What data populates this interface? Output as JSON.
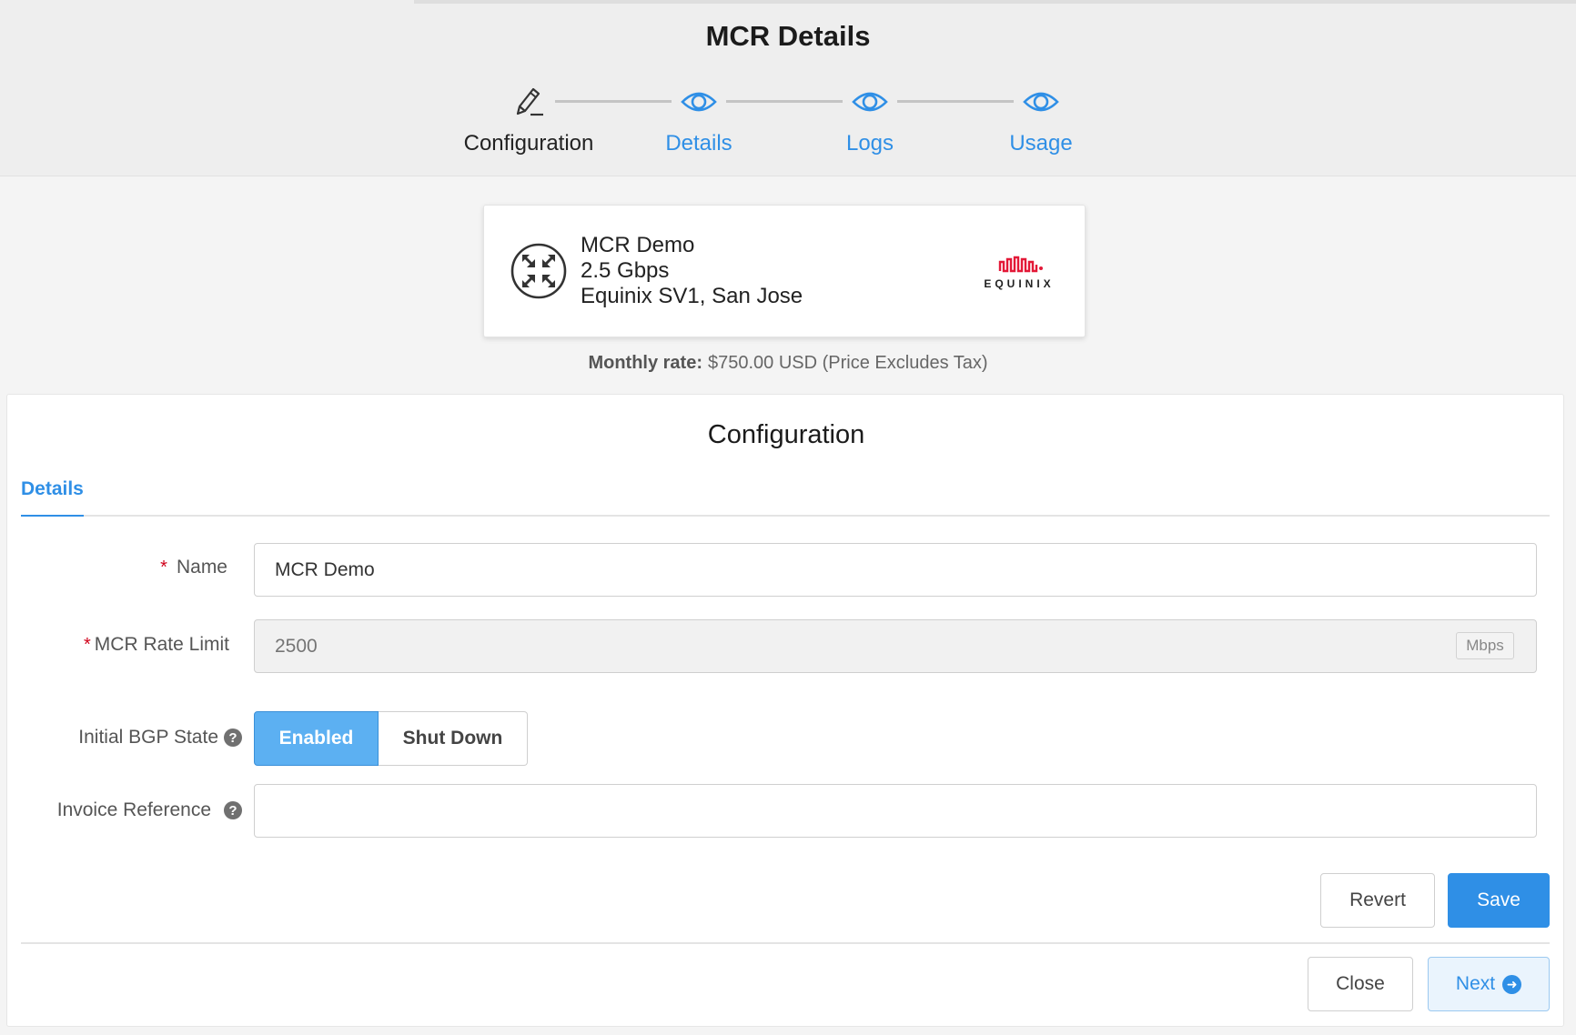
{
  "header": {
    "title": "MCR Details",
    "steps": [
      {
        "label": "Configuration",
        "icon": "pencil-icon",
        "active": true
      },
      {
        "label": "Details",
        "icon": "eye-icon",
        "active": false
      },
      {
        "label": "Logs",
        "icon": "eye-icon",
        "active": false
      },
      {
        "label": "Usage",
        "icon": "eye-icon",
        "active": false
      }
    ]
  },
  "summary": {
    "name": "MCR Demo",
    "speed": "2.5 Gbps",
    "location": "Equinix SV1, San Jose",
    "provider_logo_text": "EQUINIX",
    "icon": "mcr-arrows-icon",
    "rate_label": "Monthly rate:",
    "rate_value": "$750.00 USD (Price Excludes Tax)"
  },
  "config": {
    "title": "Configuration",
    "tab_label": "Details",
    "name_field": {
      "label": "Name",
      "required_mark": "*",
      "value": "MCR Demo"
    },
    "rate_limit_field": {
      "label": "MCR Rate Limit",
      "required_mark": "*",
      "placeholder": "2500",
      "unit": "Mbps"
    },
    "bgp_state": {
      "label": "Initial BGP State",
      "help": "?",
      "enabled_label": "Enabled",
      "shutdown_label": "Shut Down",
      "selected": "Enabled"
    },
    "invoice_field": {
      "label": "Invoice Reference",
      "help": "?",
      "value": ""
    },
    "revert_label": "Revert",
    "save_label": "Save"
  },
  "footer": {
    "close_label": "Close",
    "next_label": "Next",
    "next_icon": "arrow-right-circle-icon"
  },
  "colors": {
    "accent": "#2f8fe6",
    "toggle_on": "#5cb0f2",
    "required": "#d0021b",
    "equinix_red": "#e31837"
  }
}
